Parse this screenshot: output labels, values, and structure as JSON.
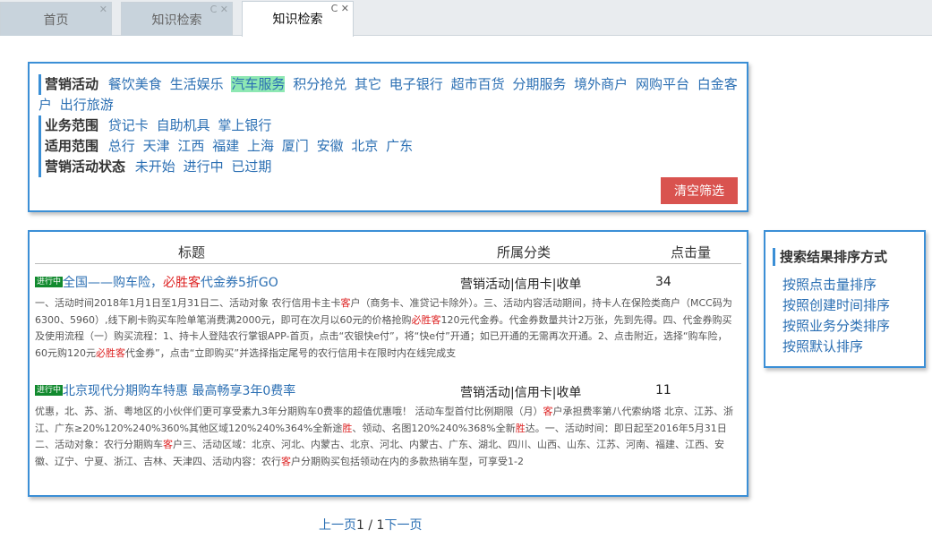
{
  "tabs": [
    {
      "label": "首页"
    },
    {
      "label": "知识检索"
    },
    {
      "label": "知识检索"
    }
  ],
  "tab_controls": {
    "refresh": "C",
    "close": "✕"
  },
  "filters": {
    "marketing": {
      "label": "营销活动",
      "options": [
        "餐饮美食",
        "生活娱乐",
        "汽车服务",
        "积分抢兑",
        "其它",
        "电子银行",
        "超市百货",
        "分期服务",
        "境外商户",
        "网购平台",
        "白金客户",
        "出行旅游"
      ],
      "selected": "汽车服务"
    },
    "business": {
      "label": "业务范围",
      "options": [
        "贷记卡",
        "自助机具",
        "掌上银行"
      ]
    },
    "scope": {
      "label": "适用范围",
      "options": [
        "总行",
        "天津",
        "江西",
        "福建",
        "上海",
        "厦门",
        "安徽",
        "北京",
        "广东"
      ]
    },
    "status": {
      "label": "营销活动状态",
      "options": [
        "未开始",
        "进行中",
        "已过期"
      ]
    },
    "clear_label": "清空筛选"
  },
  "results": {
    "headers": {
      "title": "标题",
      "category": "所属分类",
      "clicks": "点击量"
    },
    "items": [
      {
        "badge": "进行中",
        "title_a": "全国——购车险，",
        "title_hl": "必胜客",
        "title_b": "代金券5折GO",
        "category": "营销活动|信用卡|收单",
        "clicks": "34",
        "snippet_a": "一、活动时间2018年1月1日至1月31日二、活动对象 农行信用卡主卡",
        "snippet_hl1": "客",
        "snippet_b": "户（商务卡、准贷记卡除外）。三、活动内容活动期间，持卡人在保险类商户（MCC码为6300、5960）,线下刷卡购买车险单笔消费满2000元，即可在次月以60元的价格抢购",
        "snippet_hl2": "必胜客",
        "snippet_c": "120元代金券。代金券数量共计2万张，先到先得。四、代金券购买及使用流程（一）购买流程：1、持卡人登陆农行掌银APP-首页，点击“农银快e付”，将“快e付”开通；如已开通的无需再次开通。2、点击附近，选择“购车险，60元购120元",
        "snippet_hl3": "必胜客",
        "snippet_d": "代金券”，点击“立即购买”并选择指定尾号的农行信用卡在限时内在线完成支"
      },
      {
        "badge": "进行中",
        "title_a": "北京现代分期购车特惠 最高畅享3年0费率",
        "category": "营销活动|信用卡|收单",
        "clicks": "11",
        "snippet_a": "优惠，北、苏、浙、粤地区的小伙伴们更可享受素九3年分期购车0费率的超值优惠哦！ 活动车型首付比例期限（月）",
        "snippet_hl1": "客",
        "snippet_b": "户承担费率第八代索纳塔 北京、江苏、浙江、广东≥20%120%240%360%其他区域120%240%364%全新途",
        "snippet_hl2": "胜",
        "snippet_c": "、领动、名图120%240%368%全新",
        "snippet_hl3": "胜",
        "snippet_d": "达。一、活动时间：即日起至2016年5月31日二、活动对象：农行分期购车",
        "snippet_hl4": "客",
        "snippet_e": "户三、活动区域：北京、河北、内蒙古、北京、河北、内蒙古、广东、湖北、四川、山西、山东、江苏、河南、福建、江西、安徽、辽宁、宁夏、浙江、吉林、天津四、活动内容：农行",
        "snippet_hl5": "客",
        "snippet_f": "户分期购买包括领动在内的多款热销车型，可享受1-2"
      }
    ]
  },
  "pagination": {
    "prev": "上一页",
    "current": "1",
    "sep": " / ",
    "total": "1",
    "next": "下一页"
  },
  "sort": {
    "title": "搜索结果排序方式",
    "options": [
      "按照点击量排序",
      "按照创建时间排序",
      "按照业务分类排序",
      "按照默认排序"
    ]
  },
  "colors": {
    "accent": "#3b8fd6",
    "link": "#2b6fb3",
    "danger": "#d9534f",
    "badge": "#118a2e",
    "highlight": "#d22",
    "selected": "#8ee8b3"
  }
}
